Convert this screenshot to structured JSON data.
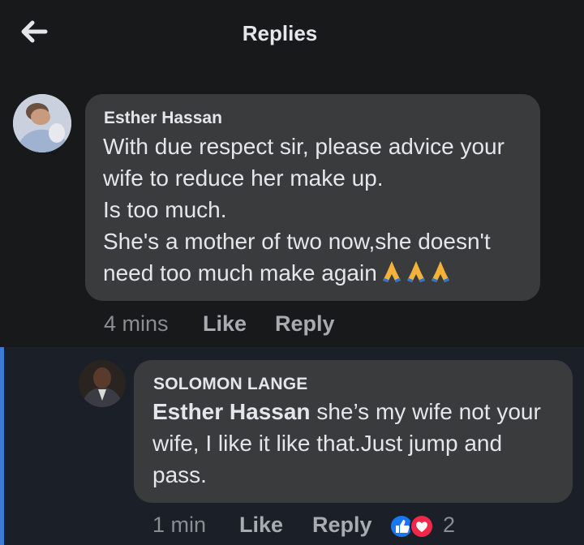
{
  "header": {
    "title": "Replies",
    "back_icon": "arrow-left-icon"
  },
  "comment": {
    "author": "Esther Hassan",
    "lines": [
      "With due respect sir, please advice your",
      "wife to reduce her make up.",
      "Is too much.",
      "She's a mother of two now,she doesn't",
      "need too much make again"
    ],
    "emoji": "folded-hands-icon",
    "time": "4 mins",
    "like_label": "Like",
    "reply_label": "Reply"
  },
  "reply": {
    "author": "SOLOMON LANGE",
    "mention": "Esther Hassan",
    "text_part1": " she’s my wife not your",
    "text_line2": "wife, I like it like that.Just jump and",
    "text_line3": "pass.",
    "time": "1 min",
    "like_label": "Like",
    "reply_label": "Reply",
    "reaction_count": "2",
    "reactions": [
      "like-icon",
      "heart-icon"
    ]
  },
  "colors": {
    "background": "#18191a",
    "bubble": "#3a3b3c",
    "thread_accent": "#3b7bd6",
    "like": "#1877f2",
    "love": "#f02849"
  }
}
